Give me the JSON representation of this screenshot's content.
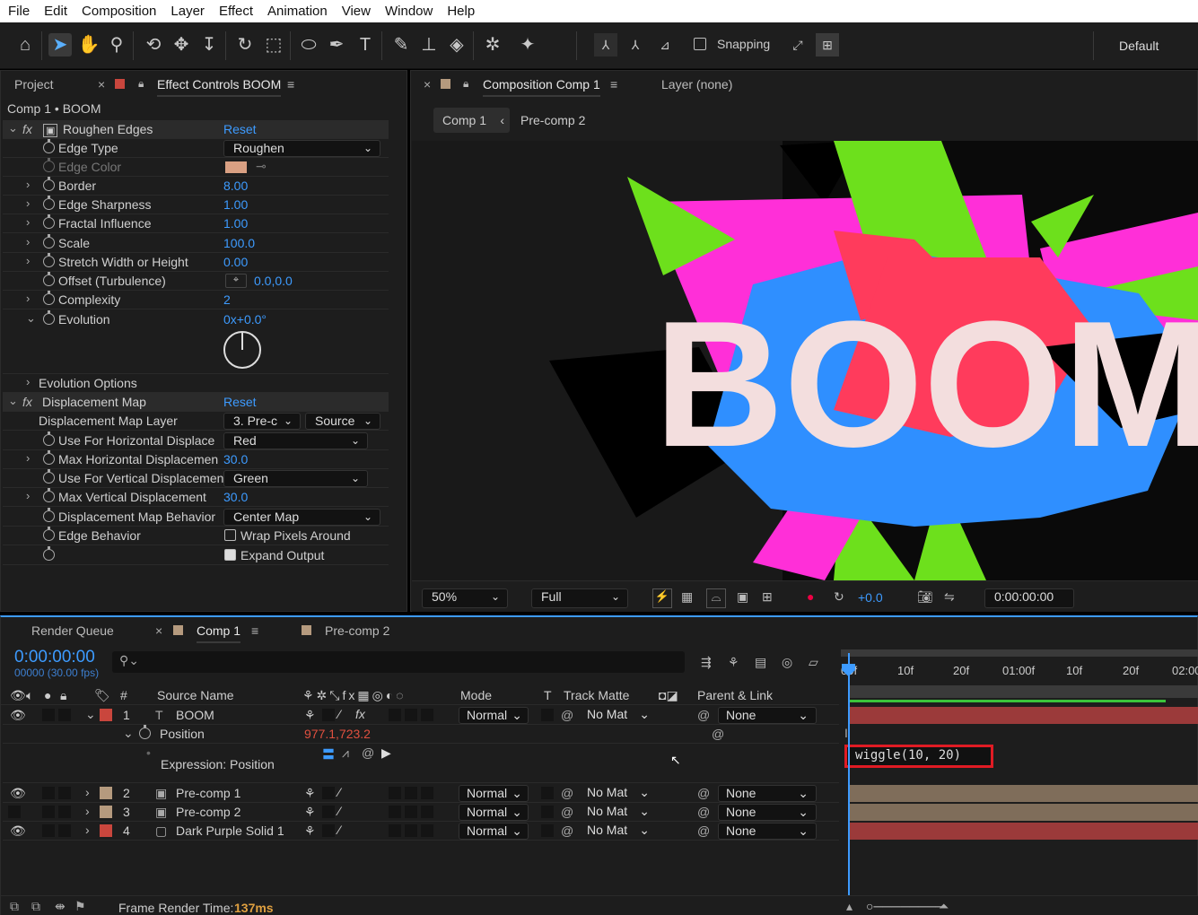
{
  "menu": [
    "File",
    "Edit",
    "Composition",
    "Layer",
    "Effect",
    "Animation",
    "View",
    "Window",
    "Help"
  ],
  "toolbar": {
    "snapping_label": "Snapping",
    "workspace": "Default",
    "icons": [
      "home-icon",
      "selection-icon",
      "hand-icon",
      "zoom-icon",
      "orbit-icon",
      "pan-icon",
      "dolly-icon",
      "rotate-icon",
      "anchor-icon",
      "ellipse-icon",
      "pen-icon",
      "type-icon",
      "brush-icon",
      "stamp-icon",
      "eraser-icon",
      "roto-icon",
      "puppet-icon"
    ]
  },
  "left_panel": {
    "tab_project": "Project",
    "tab_effect": "Effect Controls BOOM",
    "breadcrumb": "Comp 1 • BOOM",
    "roughen": {
      "name": "Roughen Edges",
      "reset": "Reset",
      "edge_type_label": "Edge Type",
      "edge_type": "Roughen",
      "edge_color_label": "Edge Color",
      "edge_color": "#d9a083",
      "border_label": "Border",
      "border": "8.00",
      "sharpness_label": "Edge Sharpness",
      "sharpness": "1.00",
      "fractal_label": "Fractal Influence",
      "fractal": "1.00",
      "scale_label": "Scale",
      "scale": "100.0",
      "stretch_label": "Stretch Width or Height",
      "stretch": "0.00",
      "offset_label": "Offset (Turbulence)",
      "offset": "0.0,0.0",
      "complexity_label": "Complexity",
      "complexity": "2",
      "evolution_label": "Evolution",
      "evolution": "0x+0.0°",
      "evo_options_label": "Evolution Options"
    },
    "displace": {
      "name": "Displacement Map",
      "reset": "Reset",
      "layer_label": "Displacement Map Layer",
      "layer": "3. Pre-c",
      "layer_src": "Source",
      "horiz_label": "Use For Horizontal Displace",
      "horiz": "Red",
      "max_h_label": "Max Horizontal Displacemen",
      "max_h": "30.0",
      "vert_label": "Use For Vertical Displacemen",
      "vert": "Green",
      "max_v_label": "Max Vertical Displacement",
      "max_v": "30.0",
      "behavior_label": "Displacement Map Behavior",
      "behavior": "Center Map",
      "edge_label": "Edge Behavior",
      "wrap": "Wrap Pixels Around",
      "expand": "Expand Output"
    }
  },
  "viewer": {
    "tab_comp": "Composition Comp 1",
    "tab_layer": "Layer (none)",
    "crumb1": "Comp 1",
    "crumb2": "Pre-comp 2",
    "zoom": "50%",
    "resolution": "Full",
    "exposure": "+0.0",
    "timecode": "0:00:00:00",
    "art_text": "BOOM"
  },
  "timeline": {
    "tab_render": "Render Queue",
    "tab_comp1": "Comp 1",
    "tab_precomp2": "Pre-comp 2",
    "timecode": "0:00:00:00",
    "frames": "00000 (30.00 fps)",
    "cols": {
      "num": "#",
      "source": "Source Name",
      "mode": "Mode",
      "t": "T",
      "matte": "Track Matte",
      "parent": "Parent & Link"
    },
    "ruler": [
      "00f",
      "10f",
      "20f",
      "01:00f",
      "10f",
      "20f",
      "02:00"
    ],
    "layers": [
      {
        "num": "1",
        "name": "BOOM",
        "mode": "Normal",
        "matte": "No Mat",
        "parent": "None",
        "color": "#c9463d",
        "bar": "#9b3a3a"
      },
      {
        "num": "2",
        "name": "Pre-comp 1",
        "mode": "Normal",
        "matte": "No Mat",
        "parent": "None",
        "color": "#b59a7e",
        "bar": "#7f6d5a"
      },
      {
        "num": "3",
        "name": "Pre-comp 2",
        "mode": "Normal",
        "matte": "No Mat",
        "parent": "None",
        "color": "#b59a7e",
        "bar": "#7f6d5a"
      },
      {
        "num": "4",
        "name": "Dark Purple Solid 1",
        "mode": "Normal",
        "matte": "No Mat",
        "parent": "None",
        "color": "#c9463d",
        "bar": "#9b3a3a"
      }
    ],
    "position_label": "Position",
    "position_value": "977.1,723.2",
    "expression_label": "Expression: Position",
    "expression_code": "wiggle(10, 20)",
    "render_time_label": "Frame Render Time:",
    "render_time": "137ms"
  }
}
